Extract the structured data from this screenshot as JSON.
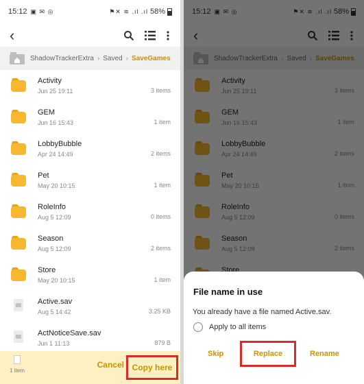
{
  "status": {
    "time": "15:12",
    "icons": "▣ ✉ ◎",
    "signal": "⚑✕ ≋ .ıl .ıl",
    "battery": "58%"
  },
  "breadcrumb": [
    "ShadowTrackerExtra",
    "Saved",
    "SaveGames"
  ],
  "left_items": [
    {
      "name": "Activity",
      "date": "Jun 25 19:11",
      "count": "3 items",
      "icon": "folder-icon"
    },
    {
      "name": "GEM",
      "date": "Jun 16 15:43",
      "count": "1 item",
      "icon": "folder-icon"
    },
    {
      "name": "LobbyBubble",
      "date": "Apr 24 14:49",
      "count": "2 items",
      "icon": "folder-icon"
    },
    {
      "name": "Pet",
      "date": "May 20 10:15",
      "count": "1 item",
      "icon": "folder-icon"
    },
    {
      "name": "RoleInfo",
      "date": "Aug 5 12:09",
      "count": "0 items",
      "icon": "folder-icon"
    },
    {
      "name": "Season",
      "date": "Aug 5 12:09",
      "count": "2 items",
      "icon": "folder-icon"
    },
    {
      "name": "Store",
      "date": "May 20 10:15",
      "count": "1 item",
      "icon": "folder-icon"
    },
    {
      "name": "Active.sav",
      "date": "Aug 5 14:42",
      "count": "3.25 KB",
      "icon": "file-icon"
    },
    {
      "name": "ActNoticeSave.sav",
      "date": "Jun 1 11:13",
      "count": "879 B",
      "icon": "file-icon"
    }
  ],
  "right_items": [
    {
      "name": "Activity",
      "date": "Jun 25 19:11",
      "count": "3 items",
      "icon": "folder-icon"
    },
    {
      "name": "GEM",
      "date": "Jun 16 15:43",
      "count": "1 item",
      "icon": "folder-icon"
    },
    {
      "name": "LobbyBubble",
      "date": "Apr 24 14:49",
      "count": "2 items",
      "icon": "folder-icon"
    },
    {
      "name": "Pet",
      "date": "May 20 10:15",
      "count": "1 item",
      "icon": "folder-icon"
    },
    {
      "name": "RoleInfo",
      "date": "Aug 5 12:09",
      "count": "0 items",
      "icon": "folder-icon"
    },
    {
      "name": "Season",
      "date": "Aug 5 12:09",
      "count": "2 items",
      "icon": "folder-icon"
    },
    {
      "name": "Store",
      "date": "",
      "count": "",
      "icon": "folder-icon"
    }
  ],
  "bottom": {
    "clip_label": "1 item",
    "cancel": "Cancel",
    "copy_here": "Copy here"
  },
  "dialog": {
    "title": "File name in use",
    "message": "You already have a file named Active.sav.",
    "apply_all": "Apply to all items",
    "skip": "Skip",
    "replace": "Replace",
    "rename": "Rename"
  },
  "colors": {
    "accent": "#c89200",
    "folder": "#f6b82e",
    "highlight": "#d92b2b"
  }
}
